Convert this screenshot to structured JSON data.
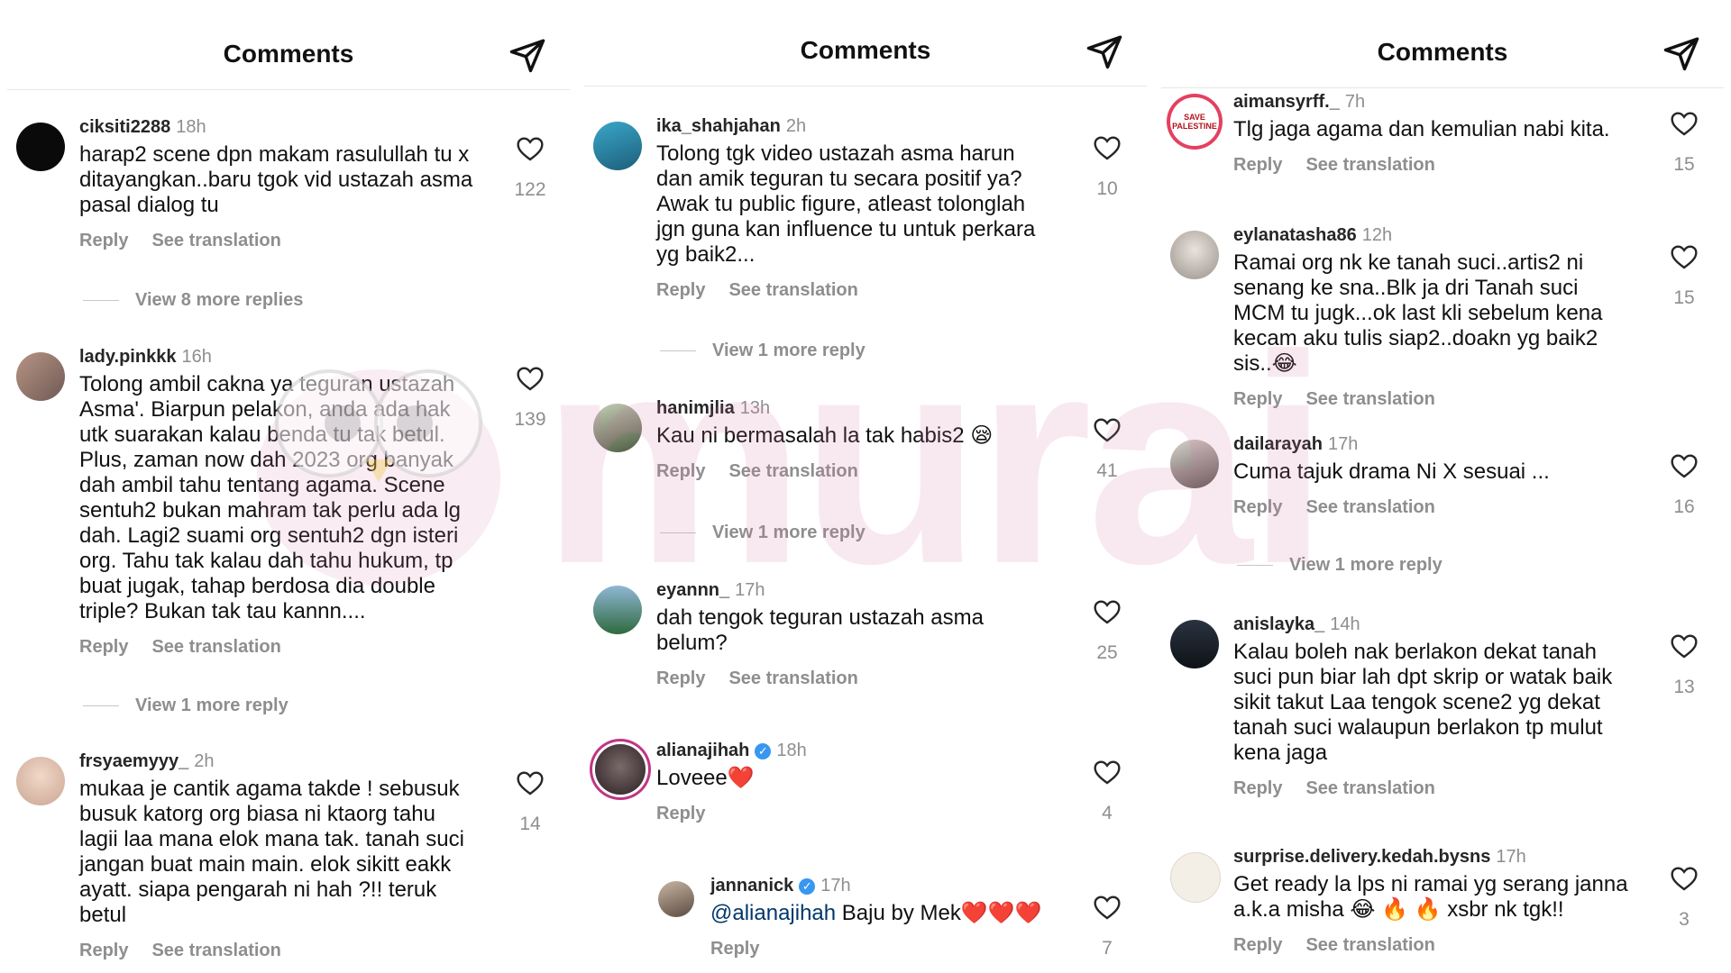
{
  "panels": [
    {
      "header": {
        "title": "Comments"
      },
      "comments": [
        {
          "user": "ciksiti2288",
          "time": "18h",
          "text": "harap2 scene dpn makam rasulullah tu x ditayangkan..baru tgok vid ustazah asma pasal dialog tu",
          "reply": "Reply",
          "translate": "See translation",
          "likes": "122",
          "more": "View 8 more replies"
        },
        {
          "user": "lady.pinkkk",
          "time": "16h",
          "text": "Tolong ambil cakna ya teguran ustazah Asma'. Biarpun pelakon, anda ada hak utk suarakan kalau benda tu tak betul. Plus, zaman now dah 2023 org banyak dah ambil tahu tentang agama. Scene sentuh2 bukan mahram tak perlu ada lg dah. Lagi2 suami org sentuh2 dgn isteri org. Tahu tak kalau dah tahu hukum, tp buat jugak, tahap berdosa dia double triple? Bukan tak tau kannn....",
          "reply": "Reply",
          "translate": "See translation",
          "likes": "139",
          "more": "View 1 more reply"
        },
        {
          "user": "frsyaemyyy_",
          "time": "2h",
          "text": "mukaa je cantik agama takde ! sebusuk busuk katorg org biasa ni ktaorg tahu lagii laa mana elok mana tak. tanah suci jangan buat main main. elok sikitt eakk ayatt. siapa pengarah ni hah ?!! teruk betul",
          "reply": "Reply",
          "translate": "See translation",
          "likes": "14"
        }
      ]
    },
    {
      "header": {
        "title": "Comments"
      },
      "comments": [
        {
          "user": "ika_shahjahan",
          "time": "2h",
          "text": "Tolong tgk video ustazah asma harun dan amik teguran tu secara positif ya? Awak tu public figure, atleast tolonglah jgn guna kan influence tu untuk perkara yg baik2...",
          "reply": "Reply",
          "translate": "See translation",
          "likes": "10",
          "more": "View 1 more reply"
        },
        {
          "user": "hanimjlia",
          "time": "13h",
          "text": "Kau ni bermasalah la tak habis2 😪",
          "reply": "Reply",
          "translate": "See translation",
          "likes": "41",
          "more": "View 1 more reply"
        },
        {
          "user": "eyannn_",
          "time": "17h",
          "text": "dah tengok teguran ustazah asma belum?",
          "reply": "Reply",
          "translate": "See translation",
          "likes": "25"
        },
        {
          "user": "alianajihah",
          "time": "18h",
          "text": "Loveee❤️",
          "reply": "Reply",
          "likes": "4"
        },
        {
          "user": "jannanick",
          "time": "17h",
          "mention": "@alianajihah",
          "text": " Baju by Mek❤️❤️❤️",
          "reply": "Reply",
          "likes": "7"
        }
      ]
    },
    {
      "header": {
        "title": "Comments"
      },
      "comments": [
        {
          "user": "aimansyrff._",
          "time": "7h",
          "text": "Tlg jaga agama dan kemulian nabi kita.",
          "reply": "Reply",
          "translate": "See translation",
          "likes": "15",
          "avatar_label": "SAVE PALESTINE"
        },
        {
          "user": "eylanatasha86",
          "time": "12h",
          "text": "Ramai org nk ke tanah suci..artis2 ni senang ke sna..Blk ja dri Tanah suci MCM tu jugk...ok last kli sebelum kena kecam aku tulis siap2..doakn yg baik2 sis..😂",
          "reply": "Reply",
          "translate": "See translation",
          "likes": "15"
        },
        {
          "user": "dailarayah",
          "time": "17h",
          "text": "Cuma tajuk drama Ni X sesuai ...",
          "reply": "Reply",
          "translate": "See translation",
          "likes": "16",
          "more": "View 1 more reply"
        },
        {
          "user": "anislayka_",
          "time": "14h",
          "text": "Kalau boleh nak berlakon dekat tanah suci pun biar lah dpt skrip or watak baik sikit takut Laa tengok scene2 yg dekat tanah suci walaupun berlakon tp mulut kena jaga",
          "reply": "Reply",
          "translate": "See translation",
          "likes": "13"
        },
        {
          "user": "surprise.delivery.kedah.bysns",
          "time": "17h",
          "text": "Get ready la lps ni ramai yg serang janna a.k.a misha 😂 🔥 🔥 xsbr nk tgk!!",
          "reply": "Reply",
          "translate": "See translation",
          "likes": "3"
        }
      ]
    }
  ],
  "watermark": "murai",
  "colors": {
    "accent_pink": "#d678aa",
    "muted": "#8e8e8e",
    "verified": "#3897f0",
    "mention": "#00376b"
  }
}
